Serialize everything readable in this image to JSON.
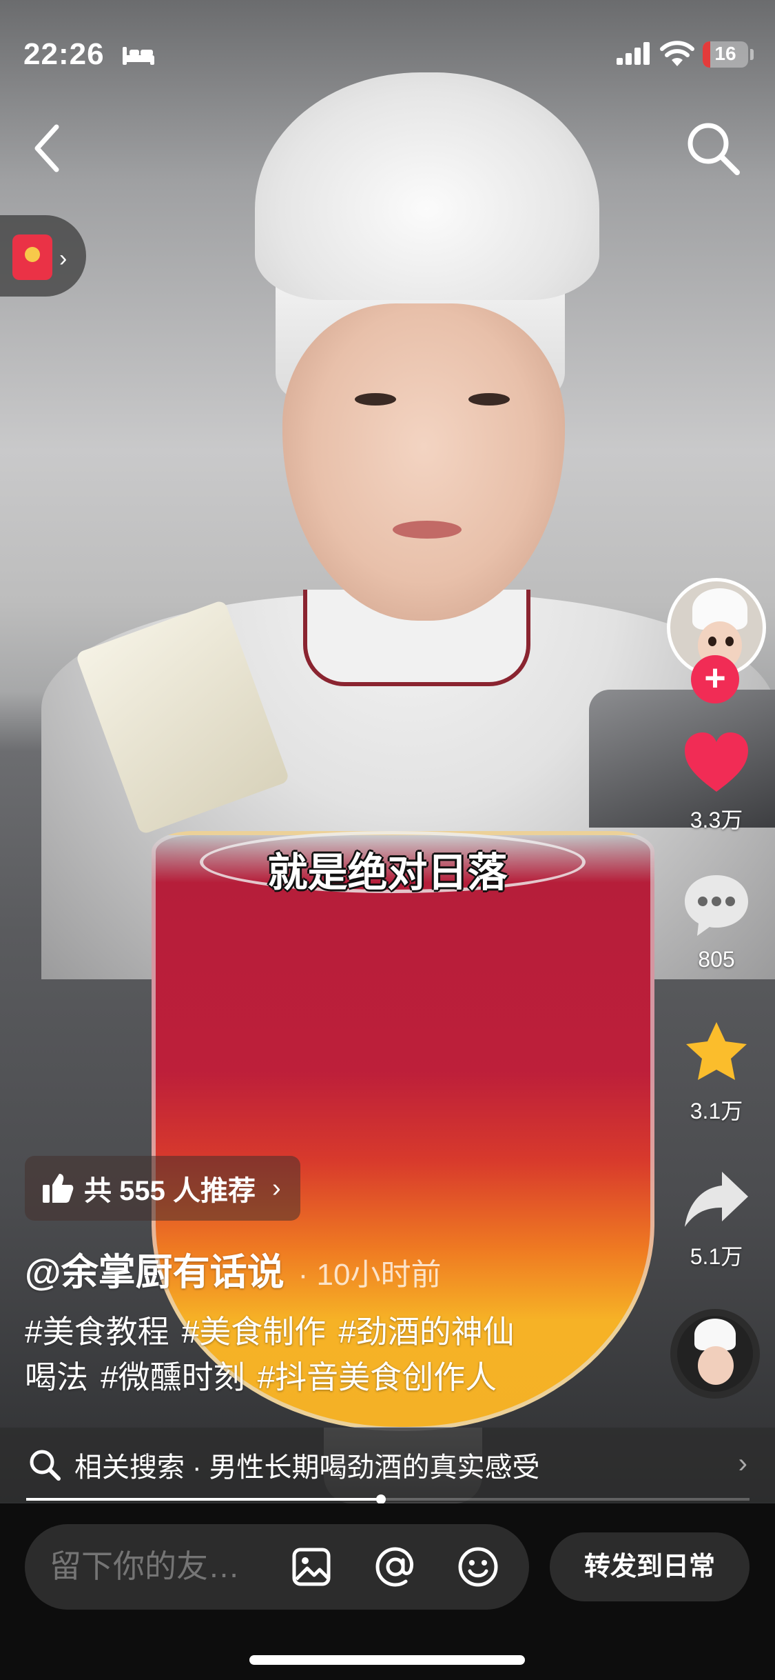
{
  "status_bar": {
    "time": "22:26",
    "battery_level": "16",
    "battery_fraction": 0.16,
    "battery_color": "#e33b3b"
  },
  "video": {
    "subtitle": "就是绝对日落"
  },
  "actions": {
    "like_count": "3.3万",
    "comment_count": "805",
    "collect_count": "3.1万",
    "share_count": "5.1万",
    "like_color": "#f12c55",
    "collect_color": "#fbbd2c"
  },
  "recommend": {
    "label": "共 555 人推荐"
  },
  "author": {
    "name": "@余掌厨有话说",
    "time": "· 10小时前"
  },
  "caption": {
    "tags": [
      "#美食教程",
      "#美食制作",
      "#劲酒的神仙",
      "喝法",
      "#微醺时刻",
      "#抖音美食创作人"
    ]
  },
  "related_search": {
    "label": "相关搜索 · 男性长期喝劲酒的真实感受"
  },
  "progress": {
    "fraction": 0.49
  },
  "bottom_bar": {
    "comment_placeholder": "留下你的友…",
    "forward_label": "转发到日常"
  },
  "icons": {
    "back": "chevron-left-icon",
    "search": "search-icon",
    "red_packet": "red-packet-icon",
    "like": "heart-icon",
    "comment": "chat-bubble-icon",
    "collect": "star-icon",
    "share": "share-arrow-icon",
    "image": "image-icon",
    "mention": "at-icon",
    "emoji": "smiley-icon",
    "recommend": "thumbs-up-icon"
  }
}
